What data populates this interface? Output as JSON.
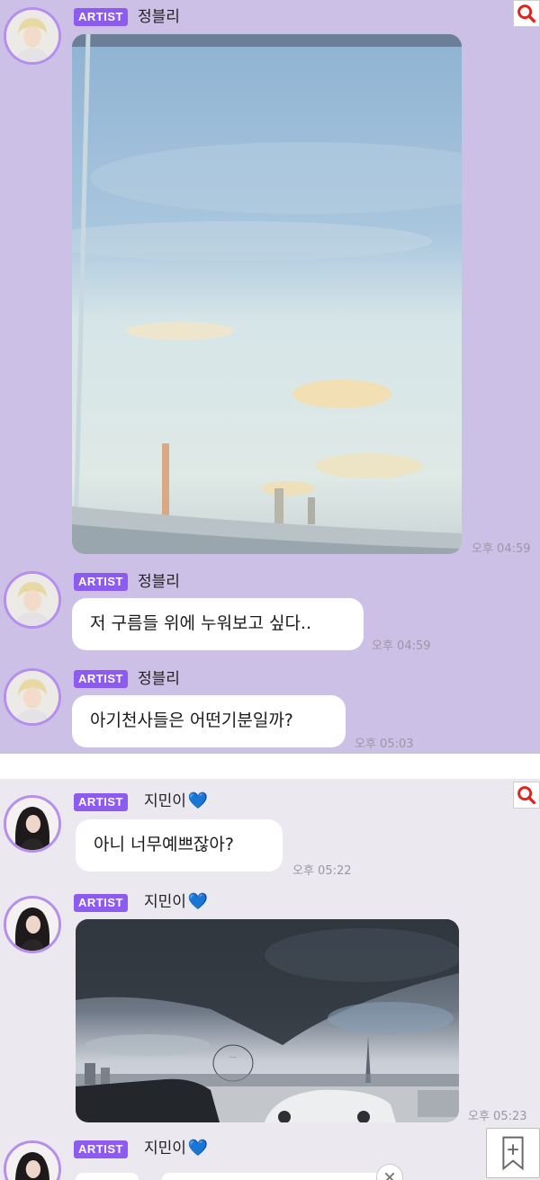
{
  "panel1": {
    "messages": [
      {
        "badge": "ARTIST",
        "sender": "정블리",
        "type": "image",
        "time": "오후 04:59"
      },
      {
        "badge": "ARTIST",
        "sender": "정블리",
        "type": "text",
        "text": "저 구름들 위에 누워보고 싶다..",
        "time": "오후 04:59"
      },
      {
        "badge": "ARTIST",
        "sender": "정블리",
        "type": "text",
        "text": "아기천사들은 어떤기분일까?",
        "time": "오후 05:03"
      }
    ]
  },
  "panel2": {
    "messages": [
      {
        "badge": "ARTIST",
        "sender": "지민이",
        "heart": "💙",
        "type": "text",
        "text": "아니 너무예쁘잖아?",
        "time": "오후 05:22"
      },
      {
        "badge": "ARTIST",
        "sender": "지민이",
        "heart": "💙",
        "type": "image",
        "time": "오후 05:23"
      },
      {
        "badge": "ARTIST",
        "sender": "지민이",
        "heart": "💙",
        "type": "partial"
      }
    ]
  },
  "icons": {
    "search": "search-icon",
    "bookmark": "bookmark-add-icon",
    "close": "close-icon"
  },
  "colors": {
    "panel1_bg": "#cdc0e6",
    "panel2_bg": "#ebe9ef",
    "badge": "#8e5bf0",
    "avatar_ring": "#b68ef0",
    "search_accent": "#e0261c",
    "heart": "#3b7fe0"
  }
}
